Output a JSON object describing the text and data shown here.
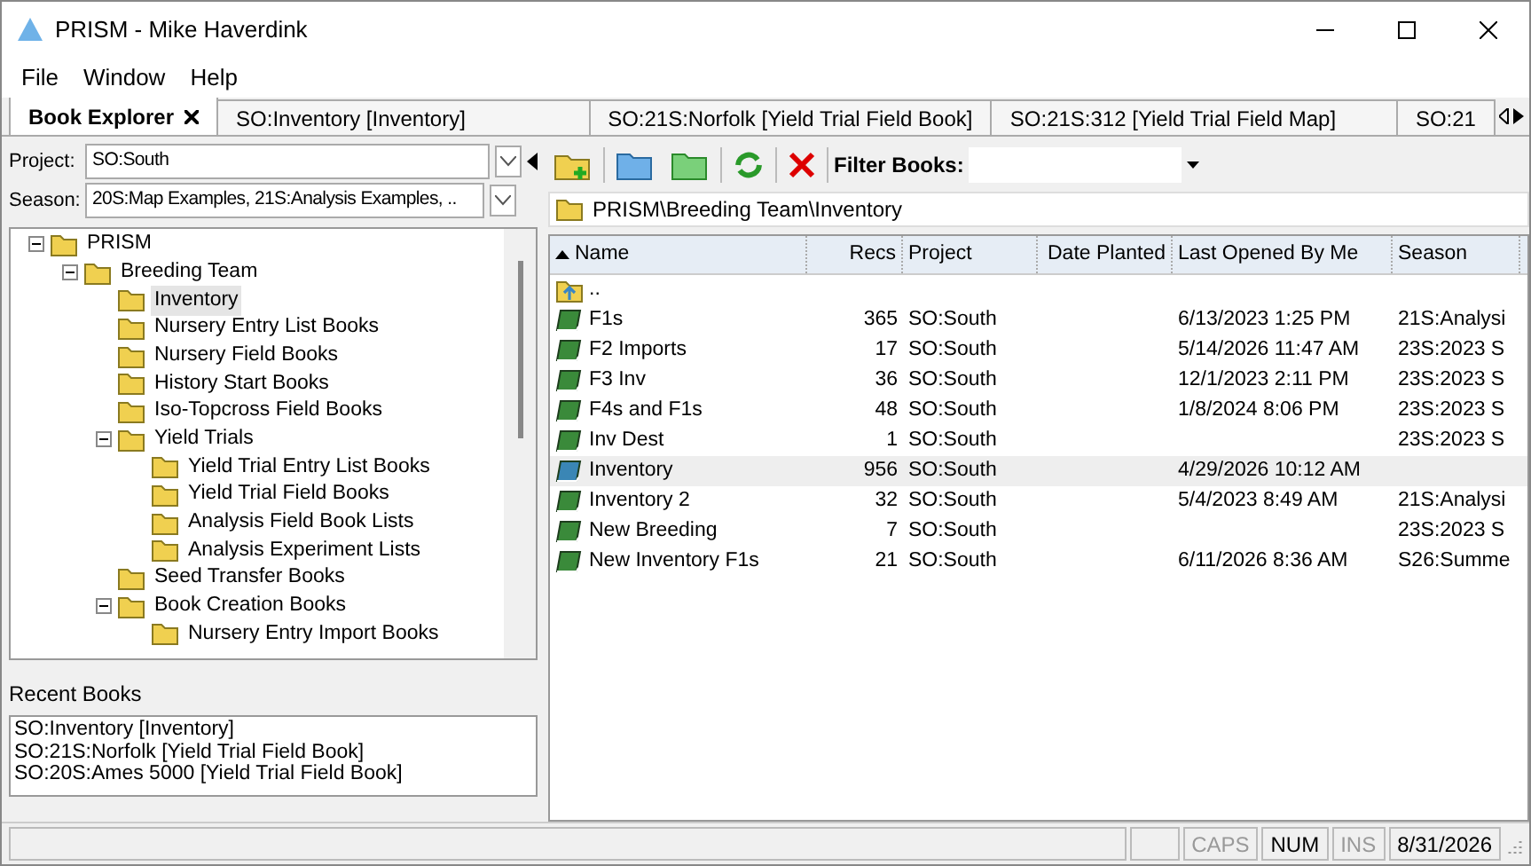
{
  "window": {
    "title": "PRISM - Mike Haverdink"
  },
  "menu": [
    "File",
    "Window",
    "Help"
  ],
  "tabs": [
    {
      "label": "Book Explorer",
      "selected": true,
      "closable": true
    },
    {
      "label": "SO:Inventory [Inventory]",
      "selected": false,
      "closable": false
    },
    {
      "label": "SO:21S:Norfolk [Yield Trial Field Book]",
      "selected": false,
      "closable": false
    },
    {
      "label": "SO:21S:312 [Yield Trial Field Map]",
      "selected": false,
      "closable": false
    },
    {
      "label": "SO:21",
      "selected": false,
      "closable": false
    }
  ],
  "filters": [
    {
      "label": "Project:",
      "value": "SO:South"
    },
    {
      "label": "Season:",
      "value": "20S:Map Examples, 21S:Analysis Examples, .."
    }
  ],
  "tree": [
    {
      "label": "PRISM",
      "expanded": true,
      "selected": false,
      "children": [
        {
          "label": "Breeding Team",
          "expanded": true,
          "selected": false,
          "children": [
            {
              "label": "Inventory",
              "selected": true
            },
            {
              "label": "Nursery Entry List Books",
              "selected": false
            },
            {
              "label": "Nursery Field Books",
              "selected": false
            },
            {
              "label": "History Start Books",
              "selected": false
            },
            {
              "label": "Iso-Topcross Field Books",
              "selected": false
            },
            {
              "label": "Yield Trials",
              "expanded": true,
              "selected": false,
              "children": [
                {
                  "label": "Yield Trial Entry List Books",
                  "selected": false
                },
                {
                  "label": "Yield Trial Field Books",
                  "selected": false
                },
                {
                  "label": "Analysis Field Book Lists",
                  "selected": false
                },
                {
                  "label": "Analysis Experiment Lists",
                  "selected": false
                }
              ]
            },
            {
              "label": "Seed Transfer Books",
              "selected": false
            },
            {
              "label": "Book Creation Books",
              "expanded": true,
              "selected": false,
              "children": [
                {
                  "label": "Nursery Entry Import Books",
                  "selected": false
                }
              ]
            }
          ]
        }
      ]
    }
  ],
  "recent_books": {
    "title": "Recent Books",
    "items": [
      "SO:Inventory [Inventory]",
      "SO:21S:Norfolk [Yield Trial Field Book]",
      "SO:20S:Ames 5000 [Yield Trial Field Book]"
    ]
  },
  "toolbar": {
    "filter_label": "Filter Books:"
  },
  "path": "PRISM\\Breeding Team\\Inventory",
  "table": {
    "columns": [
      "Name",
      "Recs",
      "Project",
      "Date Planted",
      "Last Opened By Me",
      "Season"
    ],
    "rows": [
      {
        "kind": "parent",
        "name": "..",
        "selected": false
      },
      {
        "kind": "book",
        "name": "F1s",
        "selected": false,
        "recs": "365",
        "project": "SO:South",
        "last_opened": "6/13/2023 1:25 PM",
        "season": "21S:Analysi"
      },
      {
        "kind": "book",
        "name": "F2 Imports",
        "selected": false,
        "recs": "17",
        "project": "SO:South",
        "last_opened": "5/14/2026 11:47 AM",
        "season": "23S:2023 S"
      },
      {
        "kind": "book",
        "name": "F3 Inv",
        "selected": false,
        "recs": "36",
        "project": "SO:South",
        "last_opened": "12/1/2023 2:11 PM",
        "season": "23S:2023 S"
      },
      {
        "kind": "book",
        "name": "F4s and F1s",
        "selected": false,
        "recs": "48",
        "project": "SO:South",
        "last_opened": "1/8/2024 8:06 PM",
        "season": "23S:2023 S"
      },
      {
        "kind": "book",
        "name": "Inv Dest",
        "selected": false,
        "recs": "1",
        "project": "SO:South",
        "season": "23S:2023 S"
      },
      {
        "kind": "book",
        "name": "Inventory",
        "selected": true,
        "recs": "956",
        "project": "SO:South",
        "last_opened": "4/29/2026 10:12 AM"
      },
      {
        "kind": "book",
        "name": "Inventory 2",
        "selected": false,
        "recs": "32",
        "project": "SO:South",
        "last_opened": "5/4/2023 8:49 AM",
        "season": "21S:Analysi"
      },
      {
        "kind": "book",
        "name": "New Breeding",
        "selected": false,
        "recs": "7",
        "project": "SO:South",
        "season": "23S:2023 S"
      },
      {
        "kind": "book",
        "name": "New Inventory F1s",
        "selected": false,
        "recs": "21",
        "project": "SO:South",
        "last_opened": "6/11/2026 8:36 AM",
        "season": "S26:Summe"
      }
    ]
  },
  "status_bar": {
    "indicators": [
      {
        "label": "CAPS",
        "on": false
      },
      {
        "label": "NUM",
        "on": true
      },
      {
        "label": "INS",
        "on": false
      }
    ],
    "date": "8/31/2026"
  }
}
